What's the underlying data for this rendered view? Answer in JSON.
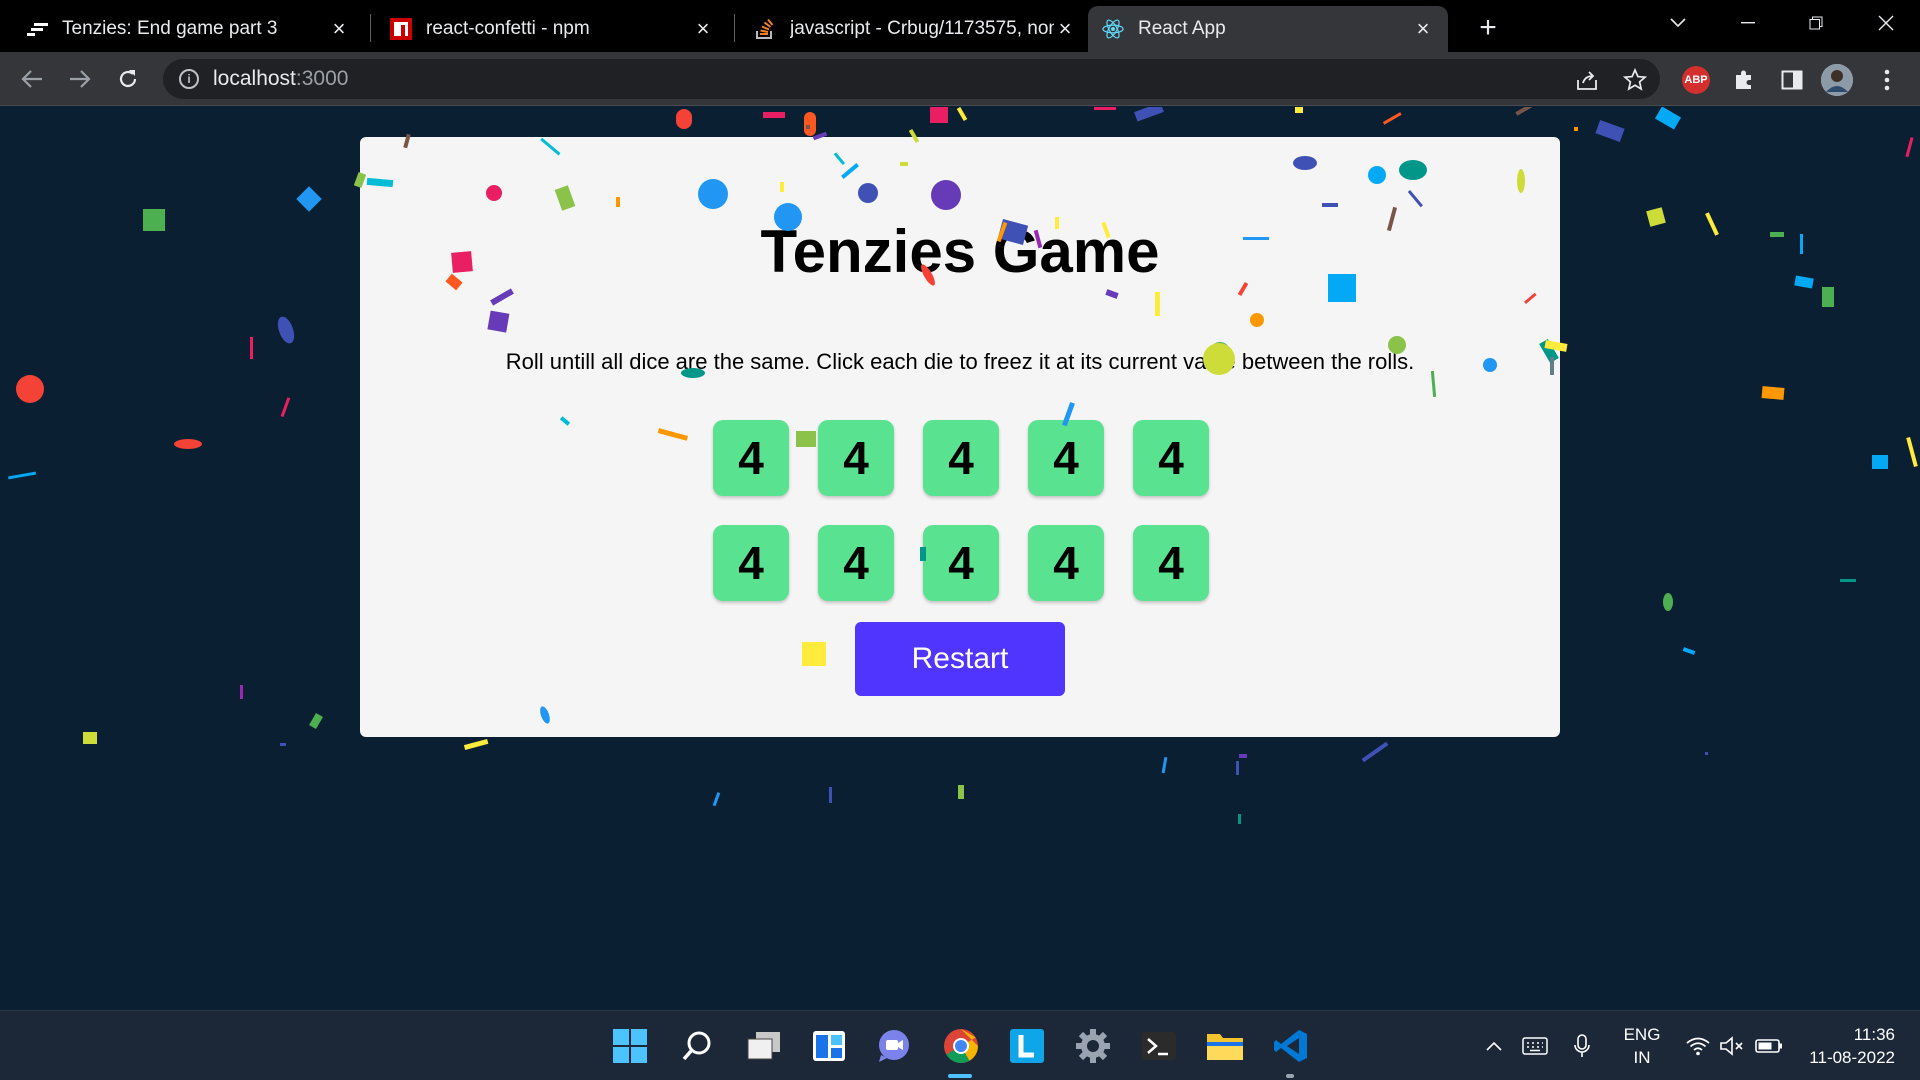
{
  "browser": {
    "tabs": [
      {
        "label": "Tenzies: End game part 3",
        "icon": "scrimba-icon"
      },
      {
        "label": "react-confetti - npm",
        "icon": "npm-icon"
      },
      {
        "label": "javascript - Crbug/1173575, non-",
        "icon": "stackoverflow-icon"
      },
      {
        "label": "React App",
        "icon": "react-icon"
      }
    ],
    "active_tab": 3,
    "url_host": "localhost",
    "url_port": ":3000"
  },
  "game": {
    "title": "Tenzies Game",
    "instructions": "Roll untill all dice are the same. Click each die to freez it at its current value between the rolls.",
    "dice": [
      "4",
      "4",
      "4",
      "4",
      "4",
      "4",
      "4",
      "4",
      "4",
      "4"
    ],
    "restart_label": "Restart",
    "colors": {
      "die": "#59e391",
      "button": "#5035ff",
      "background": "#0b1f33"
    }
  },
  "taskbar": {
    "apps": [
      "windows-start-icon",
      "search-icon",
      "task-view-icon",
      "widgets-icon",
      "teams-chat-icon",
      "chrome-icon",
      "l-app-icon",
      "settings-icon",
      "terminal-icon",
      "file-explorer-icon",
      "vscode-icon"
    ],
    "lang_line1": "ENG",
    "lang_line2": "IN",
    "time": "11:36",
    "date": "11-08-2022"
  }
}
